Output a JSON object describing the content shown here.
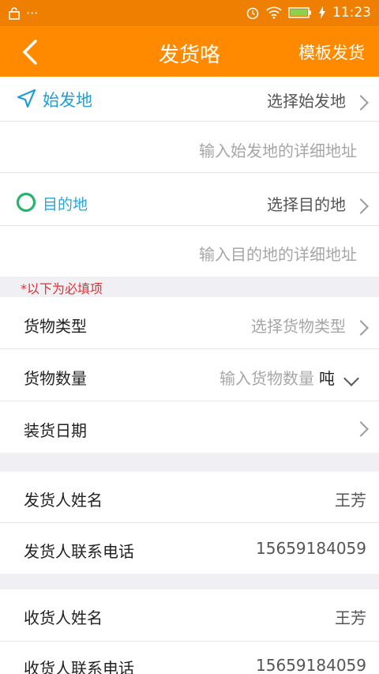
{
  "statusbar": {
    "time": "11:23",
    "dots": "···"
  },
  "header": {
    "title": "发货咯",
    "template_btn": "模板发货"
  },
  "origin": {
    "label": "始发地",
    "select": "选择始发地",
    "detail_placeholder": "输入始发地的详细地址"
  },
  "destination": {
    "label": "目的地",
    "select": "选择目的地",
    "detail_placeholder": "输入目的地的详细地址"
  },
  "required_note": "*以下为必填项",
  "cargo": {
    "type_label": "货物类型",
    "type_placeholder": "选择货物类型",
    "qty_label": "货物数量",
    "qty_placeholder": "输入货物数量",
    "unit": "吨",
    "date_label": "装货日期",
    "date_value": ""
  },
  "shipper": {
    "name_label": "发货人姓名",
    "name": "王芳",
    "phone_label": "发货人联系电话",
    "phone": "15659184059"
  },
  "receiver": {
    "name_label": "收货人姓名",
    "name": "王芳",
    "phone_label": "收货人联系电话",
    "phone": "15659184059"
  },
  "colors": {
    "nav": "#ff8a00",
    "status": "#ee7f00",
    "accent": "#29a6d8",
    "destination_circle": "#26b36b",
    "required": "#e53030"
  }
}
